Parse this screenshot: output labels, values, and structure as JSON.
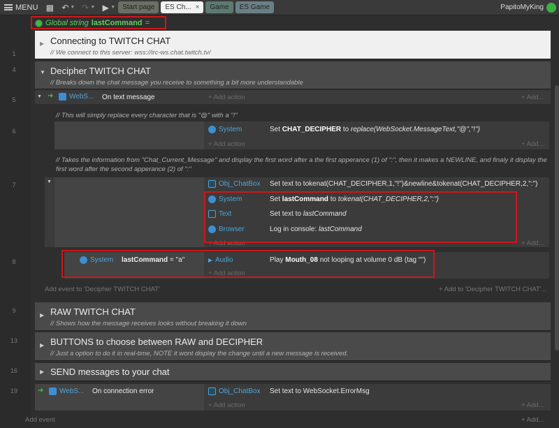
{
  "toolbar": {
    "menu_label": "MENU",
    "tabs": [
      {
        "label": "Start page"
      },
      {
        "label": "ES Ch...",
        "close": "×"
      },
      {
        "label": "Game"
      },
      {
        "label": "ES Game"
      }
    ],
    "username": "PapitoMyKing"
  },
  "global_var": {
    "prefix": "Global string",
    "name": "lastCommand",
    "suffix": "="
  },
  "line_numbers": [
    "1",
    "4",
    "5",
    "6",
    "7",
    "8",
    "9",
    "13",
    "16",
    "19"
  ],
  "groups": {
    "connect": {
      "title": "Connecting to TWITCH CHAT",
      "comment": "//  We connect to this server: wss://irc-ws.chat.twitch.tv/"
    },
    "decipher": {
      "title": "Decipher TWITCH CHAT",
      "comment": "//  Breaks down the chat message you receive to something a bit more understandable"
    },
    "raw": {
      "title": "RAW TWITCH CHAT",
      "comment": "//  Shows how the message receives looks without breaking it down"
    },
    "buttons": {
      "title": "BUTTONS to choose between RAW and DECIPHER",
      "comment": "//  Just a option to do it in real-time, NOTE it wont display the change until a new message is received."
    },
    "send": {
      "title": "SEND messages to your chat"
    }
  },
  "event5": {
    "object": "WebS...",
    "condition": "On text message",
    "add_action": "+ Add action",
    "add_more": "+ Add..."
  },
  "comment6": "//  This will simply replace every character that is \"@\" with a \"!\"",
  "event6": {
    "object": "System",
    "action_set": "Set",
    "action_var": "CHAT_DECIPHER",
    "action_to": "to",
    "action_expr": "replace(WebSocket.MessageText,\"@\",\"!\")",
    "add_action": "+ Add action",
    "add_more": "+ Add..."
  },
  "comment7": "//  Takes the information from \"Chat_Current_Message\" and display the first word after a the first apperance (1) of  \":\", then it makes a NEWLINE, and finaly it display the first word after the second apperance (2) of \":\"",
  "event7": {
    "actions": [
      {
        "object": "Obj_ChatBox",
        "text": "Set text to tokenat(CHAT_DECIPHER,1,\"!\")&newline&tokenat(CHAT_DECIPHER,2,\":\")"
      },
      {
        "object": "System",
        "pre": "Set",
        "bold": "lastCommand",
        "mid": "to",
        "italic": "tokenat(CHAT_DECIPHER,2,\":\")"
      },
      {
        "object": "Text",
        "pre": "Set text to",
        "italic": "lastCommand"
      },
      {
        "object": "Browser",
        "pre": "Log in console:",
        "italic": "lastCommand"
      }
    ],
    "add_action": "+ Add action",
    "add_more": "+ Add..."
  },
  "event8": {
    "cond_object": "System",
    "cond_var": "lastCommand",
    "cond_rest": "= \"a\"",
    "act_object": "Audio",
    "act_pre": "Play",
    "act_bold": "Mouth_08",
    "act_rest": "not looping at volume 0 dB (tag \"\")",
    "add_action": "+ Add action"
  },
  "decipher_footer": {
    "add_event": "Add event to 'Decipher TWITCH CHAT'",
    "add_event_right": "+ Add to 'Decipher TWITCH CHAT'..."
  },
  "event19": {
    "object": "WebS...",
    "condition": "On connection error",
    "act_object": "Obj_ChatBox",
    "act_text": "Set text to WebSocket.ErrorMsg",
    "add_action": "+ Add action",
    "add_more": "+ Add..."
  },
  "sheet_footer": {
    "add_event": "Add event",
    "add_more": "+ Add..."
  }
}
